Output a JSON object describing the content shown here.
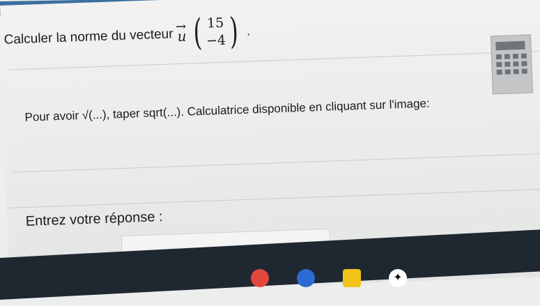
{
  "question": {
    "text": "Calculer la norme du vecteur",
    "vector_symbol": "u",
    "vector_arrow": "→",
    "components": [
      "15",
      "−4"
    ],
    "end": "."
  },
  "hint": {
    "text": "Pour avoir √(...), taper sqrt(...). Calculatrice disponible en cliquant sur l'image:"
  },
  "answer": {
    "label": "Entrez votre réponse :",
    "norm_left": "||",
    "norm_right": "||",
    "equals": "=",
    "value": ""
  },
  "icons": [
    "calculator-icon",
    "red-app-icon",
    "circle-app-icon",
    "pen-app-icon",
    "ai-app-icon"
  ]
}
